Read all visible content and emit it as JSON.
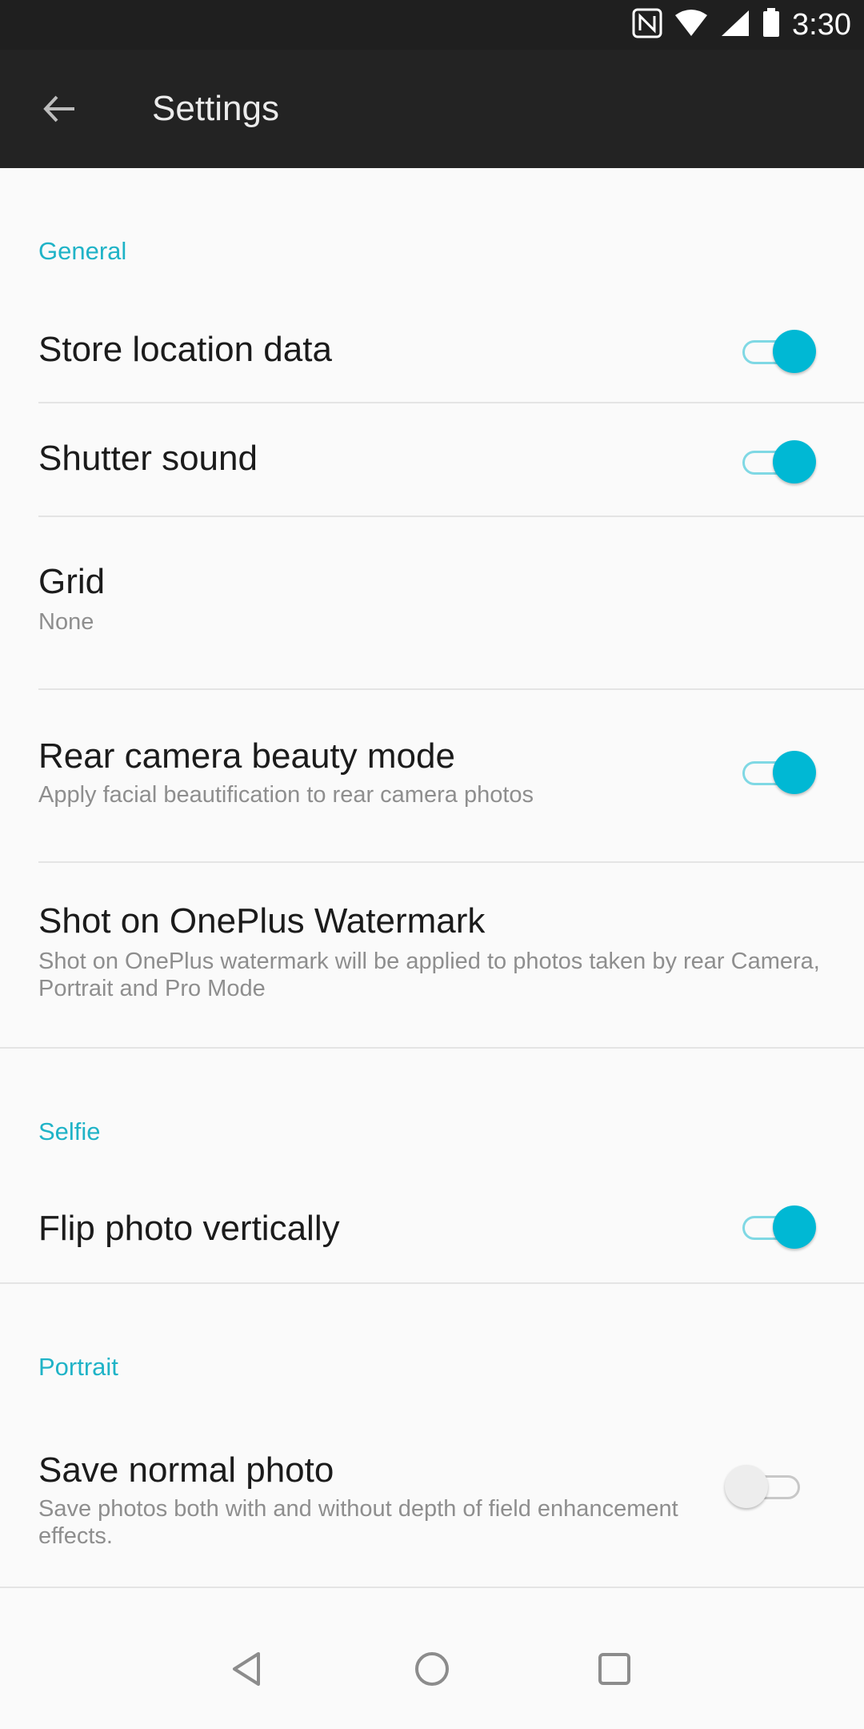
{
  "status_bar": {
    "time": "3:30"
  },
  "toolbar": {
    "title": "Settings"
  },
  "sections": {
    "general": {
      "header": "General",
      "store_location": {
        "title": "Store location data",
        "on": true
      },
      "shutter_sound": {
        "title": "Shutter sound",
        "on": true
      },
      "grid": {
        "title": "Grid",
        "value": "None"
      },
      "rear_beauty": {
        "title": "Rear camera beauty mode",
        "subtitle": "Apply facial beautification to rear camera photos",
        "on": true
      },
      "watermark": {
        "title": "Shot on OnePlus Watermark",
        "subtitle": "Shot on OnePlus watermark will be applied to photos taken by rear Camera, Portrait and Pro Mode"
      }
    },
    "selfie": {
      "header": "Selfie",
      "flip": {
        "title": "Flip photo vertically",
        "on": true
      }
    },
    "portrait": {
      "header": "Portrait",
      "save_normal": {
        "title": "Save normal photo",
        "subtitle": "Save photos both with and without depth of field enhancement effects.",
        "on": false
      }
    }
  },
  "colors": {
    "accent": "#00b8d4",
    "header": "#1fb3c7",
    "toolbar": "#232323"
  },
  "icons": {
    "back": "arrow-left-icon",
    "nfc": "nfc-icon",
    "wifi": "wifi-icon",
    "signal": "signal-icon",
    "battery": "battery-icon"
  }
}
